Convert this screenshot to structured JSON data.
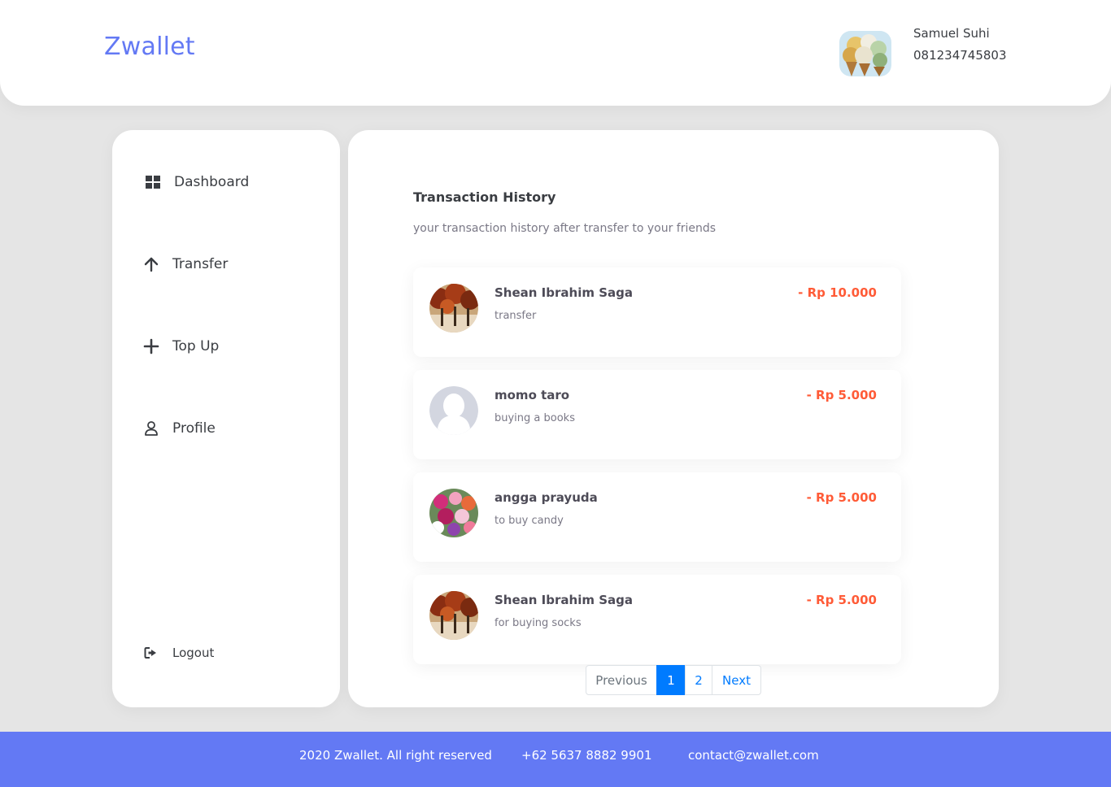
{
  "header": {
    "brand": "Zwallet",
    "user": {
      "name": "Samuel Suhi",
      "phone": "081234745803"
    }
  },
  "sidebar": {
    "items": [
      {
        "label": "Dashboard",
        "icon": "grid-icon"
      },
      {
        "label": "Transfer",
        "icon": "arrow-up-icon"
      },
      {
        "label": "Top Up",
        "icon": "plus-icon"
      },
      {
        "label": "Profile",
        "icon": "user-icon"
      }
    ],
    "logout": {
      "label": "Logout",
      "icon": "logout-icon"
    }
  },
  "main": {
    "title": "Transaction History",
    "subtitle": "your transaction history after transfer to your friends",
    "transactions": [
      {
        "name": "Shean Ibrahim Saga",
        "note": "transfer",
        "amount": "- Rp 10.000",
        "avatar": "trees-photo"
      },
      {
        "name": "momo taro",
        "note": "buying a books",
        "amount": "- Rp 5.000",
        "avatar": "default-user"
      },
      {
        "name": "angga prayuda",
        "note": "to buy candy",
        "amount": "- Rp 5.000",
        "avatar": "flowers-photo"
      },
      {
        "name": "Shean Ibrahim Saga",
        "note": "for buying socks",
        "amount": "- Rp 5.000",
        "avatar": "trees-photo"
      }
    ],
    "pagination": {
      "previous": "Previous",
      "pages": [
        "1",
        "2"
      ],
      "current": "1",
      "next": "Next"
    }
  },
  "footer": {
    "copyright": "2020 Zwallet. All right reserved",
    "phone": "+62 5637 8882 9901",
    "email": "contact@zwallet.com"
  },
  "colors": {
    "brand": "#6379f4",
    "amount": "#ff5b37",
    "page_active": "#007bff",
    "background": "#e5e5e5"
  }
}
